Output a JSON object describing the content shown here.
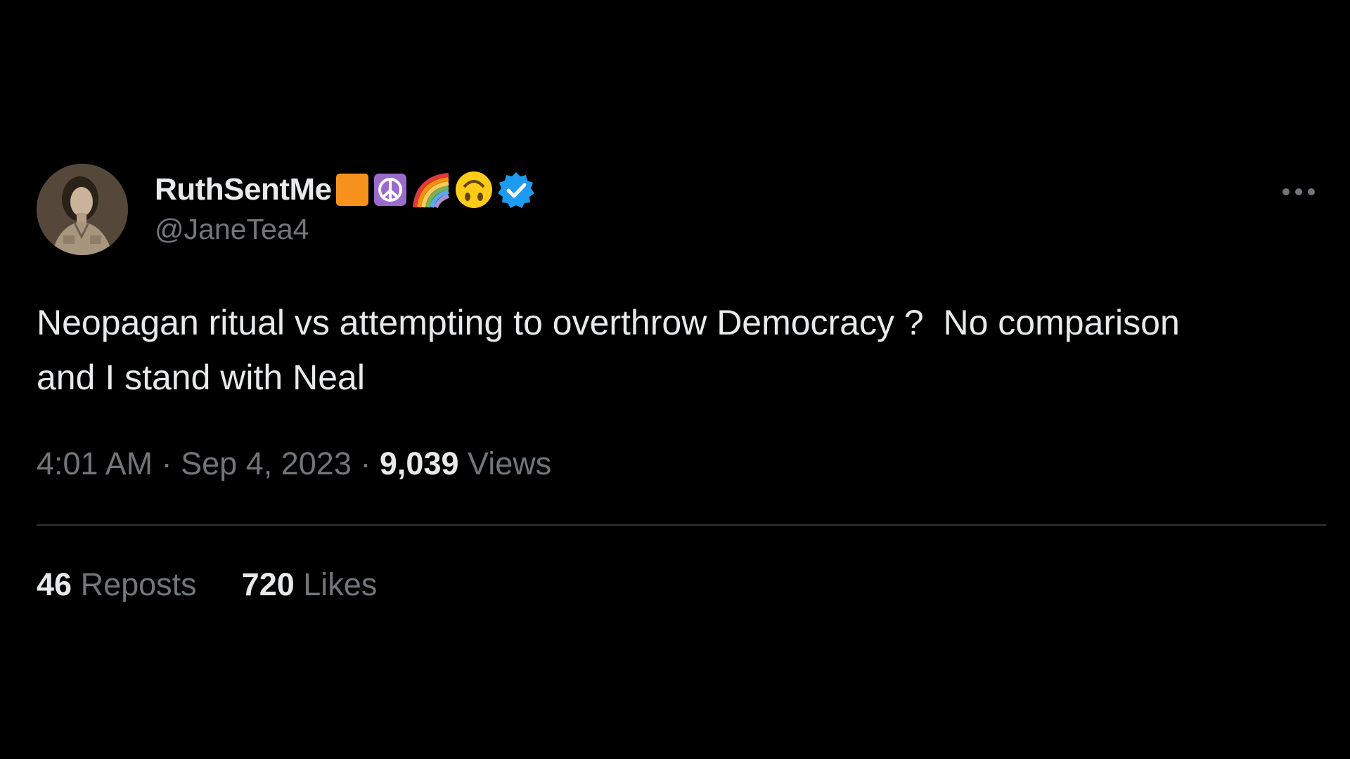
{
  "author": {
    "display_name": "RuthSentMe",
    "handle": "@JaneTea4",
    "name_emojis": [
      "orange-square-icon",
      "peace-symbol-icon",
      "rainbow-icon",
      "upside-down-face-icon"
    ],
    "verified_badge": "verified-badge-icon"
  },
  "tweet": {
    "text": "Neopagan ritual vs attempting to overthrow Democracy ?  No comparison and I stand with Neal",
    "time": "4:01 AM",
    "separator": "·",
    "date": "Sep 4, 2023",
    "views_count": "9,039",
    "views_label": "Views"
  },
  "stats": {
    "reposts_count": "46",
    "reposts_label": "Reposts",
    "likes_count": "720",
    "likes_label": "Likes"
  },
  "colors": {
    "background": "#000000",
    "text_primary": "#e7e9ea",
    "text_secondary": "#71767b",
    "verified_blue": "#1d9bf0",
    "divider": "#2f3336"
  },
  "icons": {
    "more": "more-horizontal-icon",
    "avatar": "avatar"
  }
}
